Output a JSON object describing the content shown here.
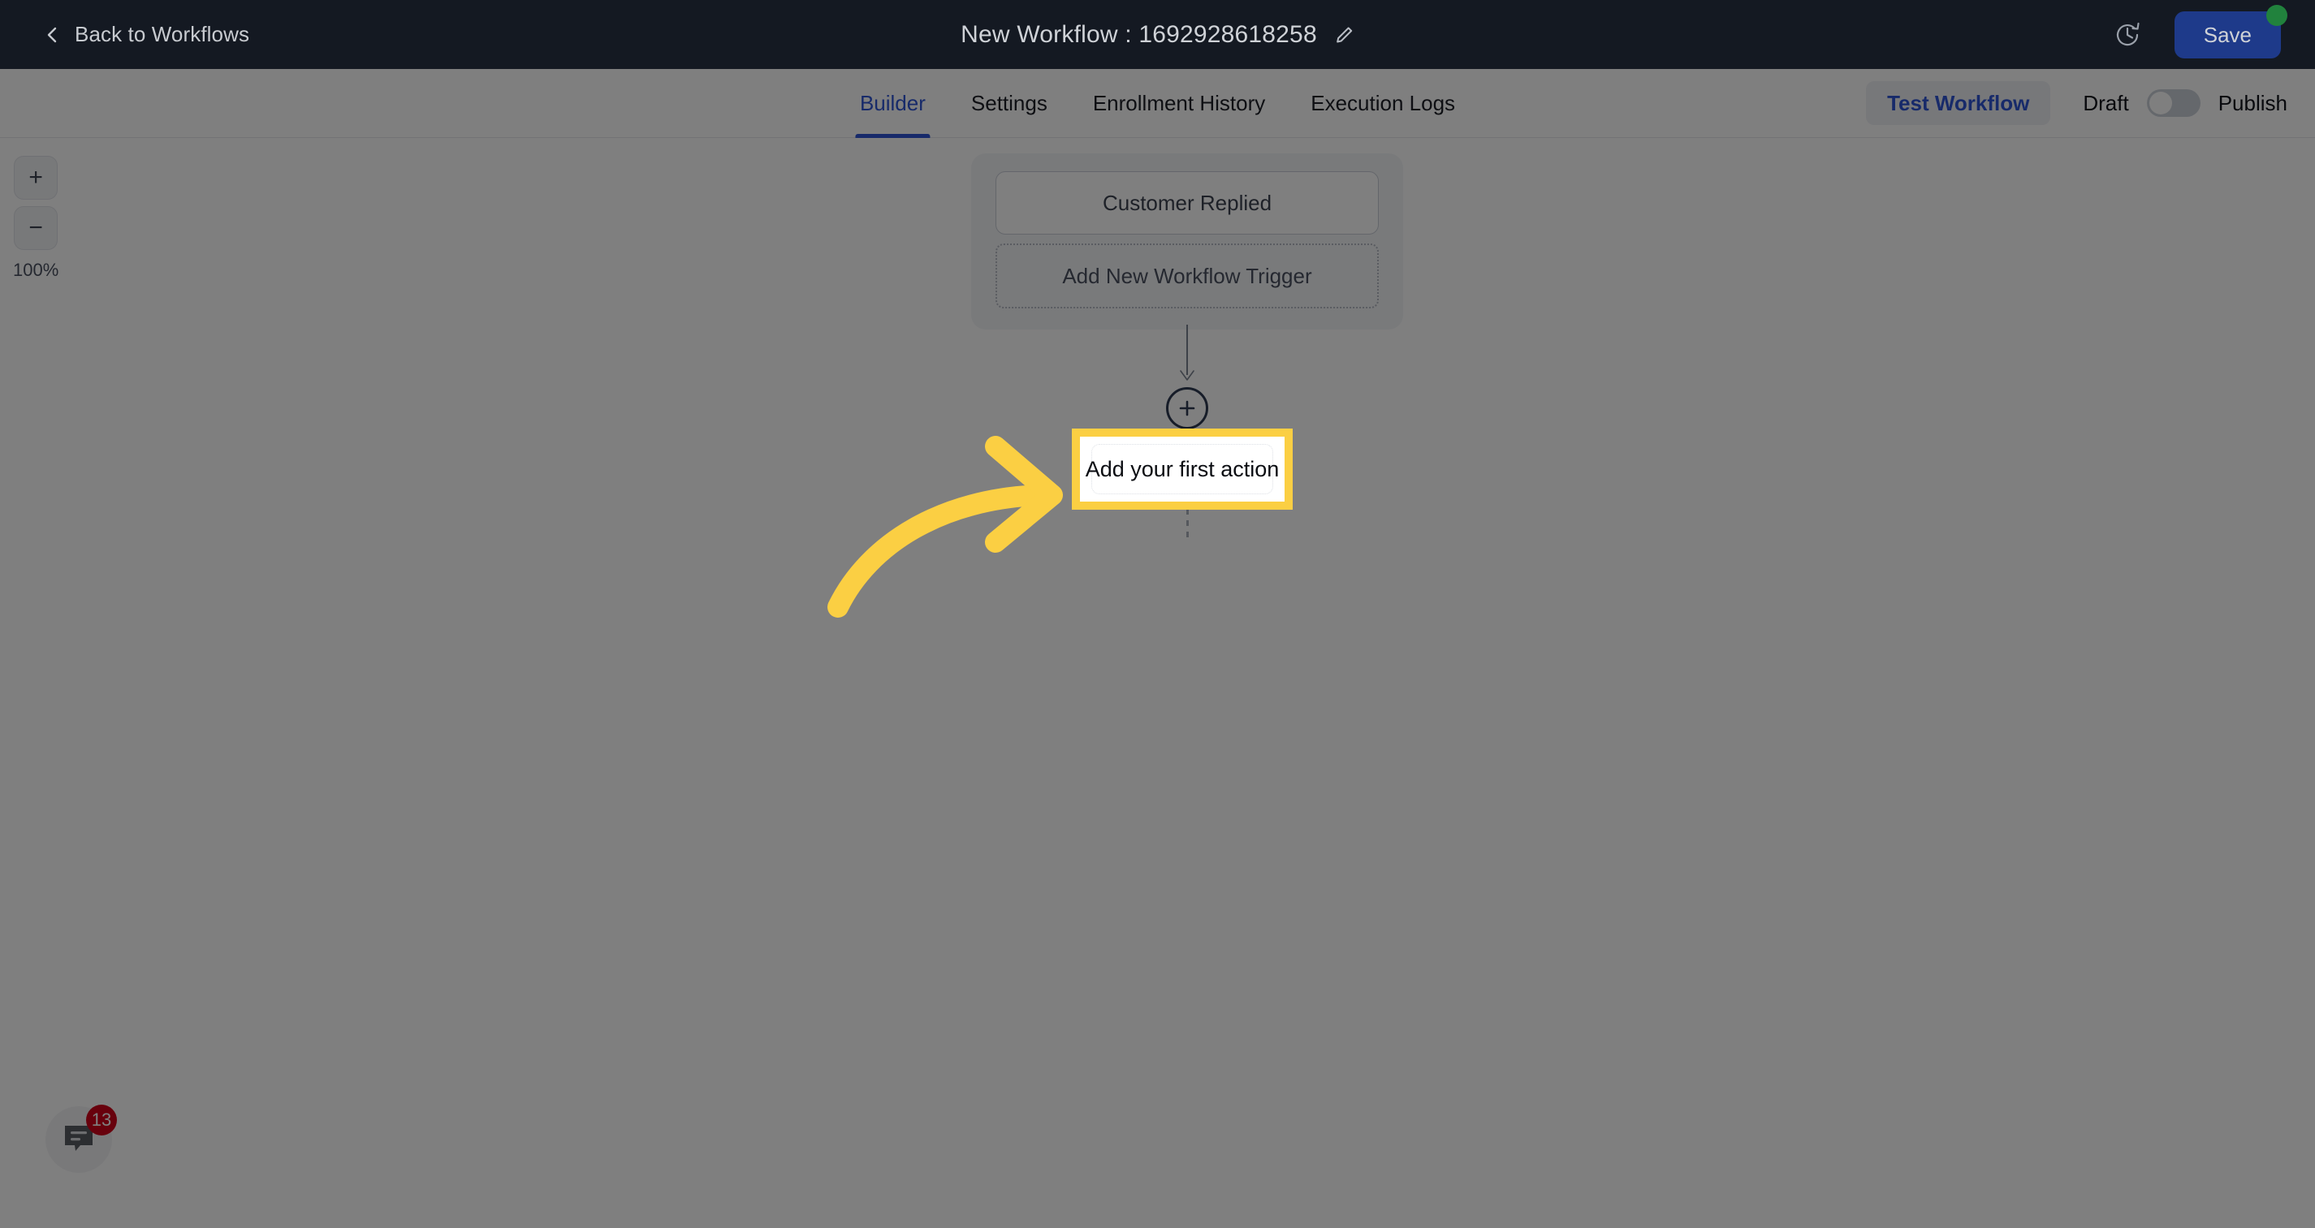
{
  "header": {
    "back_label": "Back to Workflows",
    "back_icon": "chevron-left-icon",
    "title": "New Workflow : 1692928618258",
    "edit_icon": "pencil-icon",
    "history_icon": "history-clock-icon",
    "save_label": "Save",
    "save_badge_color": "#21823d",
    "background_color": "#141922"
  },
  "tabbar": {
    "tabs": [
      {
        "label": "Builder",
        "active": true
      },
      {
        "label": "Settings",
        "active": false
      },
      {
        "label": "Enrollment History",
        "active": false
      },
      {
        "label": "Execution Logs",
        "active": false
      }
    ],
    "test_workflow_label": "Test Workflow",
    "draft_label": "Draft",
    "publish_label": "Publish",
    "toggle_state": "off",
    "accent_color": "#2f55d4"
  },
  "canvas": {
    "zoom": {
      "in_label": "+",
      "out_label": "−",
      "level": "100%"
    },
    "trigger_group": {
      "trigger_label": "Customer Replied",
      "add_trigger_label": "Add New Workflow Trigger"
    },
    "add_node_icon": "plus-circle-icon",
    "first_action_label": "Add your first action"
  },
  "chat_widget": {
    "icon": "chat-bubble-icon",
    "unread_count": "13",
    "badge_color": "#d0021b"
  },
  "coachmark": {
    "highlight_label": "Add your first action",
    "highlight_color": "#fbcf43",
    "arrow_icon": "curved-arrow-right-icon",
    "overlay_color": "rgba(0,0,0,0.5)"
  }
}
